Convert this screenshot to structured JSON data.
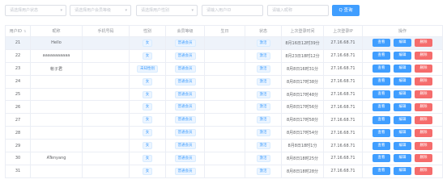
{
  "filters": {
    "select1_placeholder": "请选择用户状态",
    "select2_placeholder": "请选择用户会员等级",
    "select3_placeholder": "请选择用户性别",
    "input1_placeholder": "请输入用户ID",
    "input2_placeholder": "请输入昵称",
    "search_label": "Q 查询"
  },
  "table": {
    "headers": [
      "用户ID",
      "昵称",
      "手机号码",
      "性别",
      "会员等级",
      "生日",
      "状态",
      "上次登录时间",
      "上次登录IP",
      "操作"
    ],
    "actions": {
      "view": "查看",
      "edit": "编辑",
      "delete": "删除"
    },
    "rows": [
      {
        "id": "21",
        "nickname": "Hello",
        "phone": "",
        "gender": "女",
        "level": "普通会员",
        "birthday": "",
        "status": "激活",
        "last_login": "8月16日12时39分",
        "ip": "27.16.68.71"
      },
      {
        "id": "22",
        "nickname": "aaaaaaaaaaa",
        "phone": "",
        "gender": "女",
        "level": "普通会员",
        "birthday": "",
        "status": "激活",
        "last_login": "8月23日18时12分",
        "ip": "27.16.68.71"
      },
      {
        "id": "23",
        "nickname": "帐子君",
        "phone": "",
        "gender": "未知性别",
        "level": "普通会员",
        "birthday": "",
        "status": "激活",
        "last_login": "8月8日16时31分",
        "ip": "27.16.68.71"
      },
      {
        "id": "24",
        "nickname": "",
        "phone": "",
        "gender": "女",
        "level": "普通会员",
        "birthday": "",
        "status": "激活",
        "last_login": "8月8日17时38分",
        "ip": "27.16.68.71"
      },
      {
        "id": "25",
        "nickname": "",
        "phone": "",
        "gender": "女",
        "level": "普通会员",
        "birthday": "",
        "status": "激活",
        "last_login": "8月8日17时48分",
        "ip": "27.16.68.71"
      },
      {
        "id": "26",
        "nickname": "",
        "phone": "",
        "gender": "女",
        "level": "普通会员",
        "birthday": "",
        "status": "激活",
        "last_login": "8月8日17时56分",
        "ip": "27.16.68.71"
      },
      {
        "id": "27",
        "nickname": "",
        "phone": "",
        "gender": "女",
        "level": "普通会员",
        "birthday": "",
        "status": "激活",
        "last_login": "8月8日17时58分",
        "ip": "27.16.68.71"
      },
      {
        "id": "28",
        "nickname": "",
        "phone": "",
        "gender": "女",
        "level": "普通会员",
        "birthday": "",
        "status": "激活",
        "last_login": "8月8日17时54分",
        "ip": "27.16.68.71"
      },
      {
        "id": "29",
        "nickname": "",
        "phone": "",
        "gender": "女",
        "level": "普通会员",
        "birthday": "",
        "status": "激活",
        "last_login": "8月8日18时1分",
        "ip": "27.16.68.71"
      },
      {
        "id": "30",
        "nickname": "ATenyang",
        "phone": "",
        "gender": "女",
        "level": "普通会员",
        "birthday": "",
        "status": "激活",
        "last_login": "8月8日18时25分",
        "ip": "27.16.68.71"
      },
      {
        "id": "31",
        "nickname": "",
        "phone": "",
        "gender": "女",
        "level": "普通会员",
        "birthday": "",
        "status": "激活",
        "last_login": "8月8日18时28分",
        "ip": "27.16.68.71"
      }
    ]
  }
}
